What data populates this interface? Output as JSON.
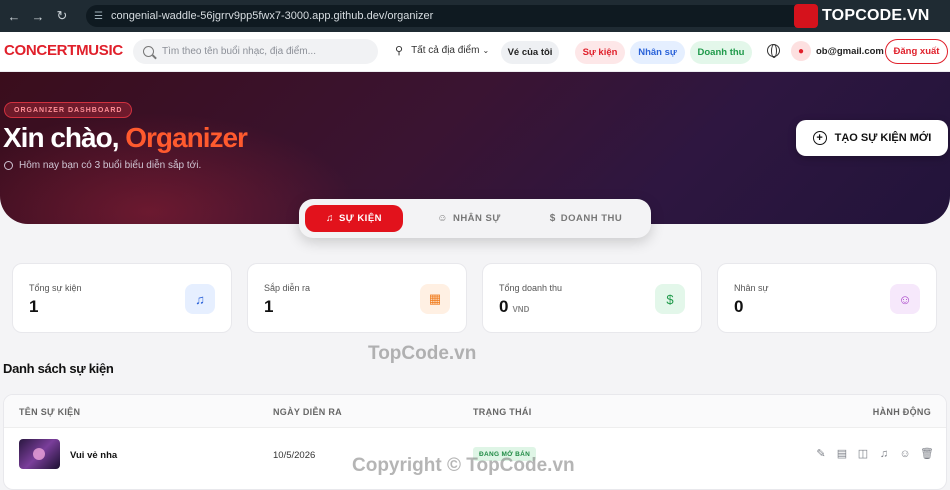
{
  "browser": {
    "url": "congenial-waddle-56jgrrv9pp5fwx7-3000.app.github.dev/organizer",
    "watermark_logo": "TOPCODE.VN"
  },
  "header": {
    "brand": "CONCERTMUSIC",
    "search_placeholder": "Tìm theo tên buổi nhạc, địa điểm...",
    "location": "Tất cả địa điểm",
    "my_tickets": "Vé của tôi",
    "nav_events": "Sự kiện",
    "nav_staff": "Nhân sự",
    "nav_revenue": "Doanh thu",
    "user_email": "ob@gmail.com",
    "logout": "Đăng xuất"
  },
  "hero": {
    "badge": "ORGANIZER DASHBOARD",
    "greeting": "Xin chào,",
    "role": "Organizer",
    "subtitle": "Hôm nay bạn có 3 buổi biểu diễn sắp tới.",
    "create_button": "TẠO SỰ KIỆN MỚI"
  },
  "tabs": [
    {
      "label": "SỰ KIỆN",
      "icon": "music-note-icon",
      "active": true
    },
    {
      "label": "NHÂN SỰ",
      "icon": "users-icon",
      "active": false
    },
    {
      "label": "DOANH THU",
      "icon": "dollar-icon",
      "active": false
    }
  ],
  "stats": [
    {
      "label": "Tổng sự kiện",
      "value": "1",
      "unit": "",
      "icon": "music-note-icon",
      "color": "#2b63d9"
    },
    {
      "label": "Sắp diễn ra",
      "value": "1",
      "unit": "",
      "icon": "calendar-icon",
      "color": "#f07a1a"
    },
    {
      "label": "Tổng doanh thu",
      "value": "0",
      "unit": "VND",
      "icon": "dollar-icon",
      "color": "#1f9a4a"
    },
    {
      "label": "Nhân sự",
      "value": "0",
      "unit": "",
      "icon": "users-icon",
      "color": "#a845c9"
    }
  ],
  "events": {
    "title": "Danh sách sự kiện",
    "columns": [
      "TÊN SỰ KIỆN",
      "NGÀY DIỄN RA",
      "TRẠNG THÁI",
      "HÀNH ĐỘNG"
    ],
    "rows": [
      {
        "name": "Vui vẻ nha",
        "date": "10/5/2026",
        "status": "ĐANG MỞ BÁN"
      }
    ]
  },
  "watermarks": [
    "TopCode.vn",
    "Copyright © TopCode.vn"
  ],
  "colors": {
    "brand_red": "#e0202b",
    "accent_orange": "#ff5a2e"
  }
}
